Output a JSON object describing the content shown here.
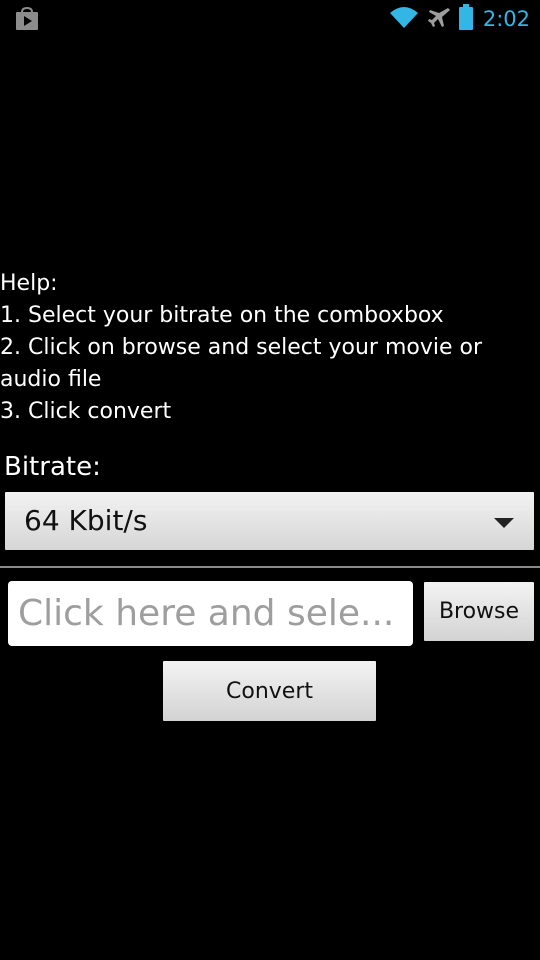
{
  "status_bar": {
    "time": "2:02",
    "icons": [
      "play-store-icon",
      "wifi-icon",
      "airplane-icon",
      "battery-icon"
    ],
    "accent_color": "#33b5e5"
  },
  "help": {
    "title": "Help:",
    "step1": "1. Select your bitrate on the comboxbox",
    "step2": "2. Click on browse and select your movie or audio file",
    "step3": "3. Click convert"
  },
  "bitrate": {
    "label": "Bitrate:",
    "selected": "64 Kbit/s"
  },
  "file": {
    "placeholder": "Click here and sele...",
    "value": ""
  },
  "buttons": {
    "browse": "Browse",
    "convert": "Convert"
  }
}
